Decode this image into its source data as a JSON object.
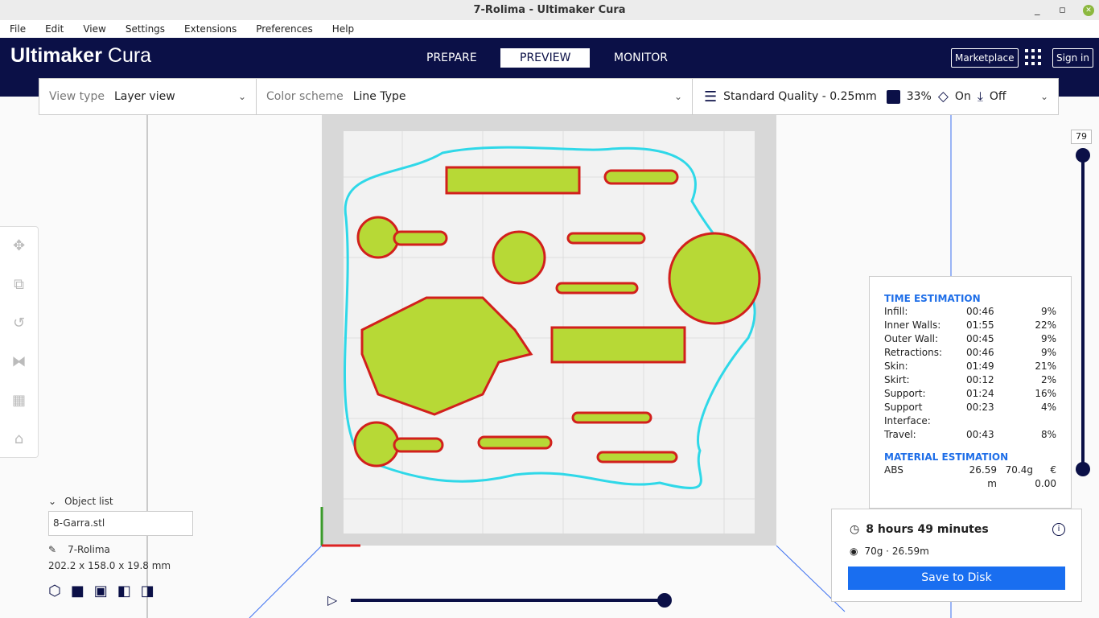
{
  "window": {
    "title": "7-Rolima - Ultimaker Cura",
    "minimize": "_",
    "maximize": "▫",
    "close": "✕"
  },
  "menu": [
    "File",
    "Edit",
    "View",
    "Settings",
    "Extensions",
    "Preferences",
    "Help"
  ],
  "header": {
    "logo_bold": "Ultimaker",
    "logo_light": " Cura",
    "tabs": [
      "PREPARE",
      "PREVIEW",
      "MONITOR"
    ],
    "active_tab": "PREVIEW",
    "marketplace": "Marketplace",
    "sign_in": "Sign in"
  },
  "view": {
    "view_type_label": "View type",
    "view_type": "Layer view",
    "color_scheme_label": "Color scheme",
    "color_scheme": "Line Type"
  },
  "print_setup": {
    "profile": "Standard Quality - 0.25mm",
    "infill": "33%",
    "support": "On",
    "adhesion": "Off"
  },
  "layer_slider": {
    "current_layer": "79",
    "position_fraction": 1.0
  },
  "time_estimation": {
    "title": "TIME ESTIMATION",
    "rows": [
      [
        "Infill:",
        "00:46",
        "9%"
      ],
      [
        "Inner Walls:",
        "01:55",
        "22%"
      ],
      [
        "Outer Wall:",
        "00:45",
        "9%"
      ],
      [
        "Retractions:",
        "00:46",
        "9%"
      ],
      [
        "Skin:",
        "01:49",
        "21%"
      ],
      [
        "Skirt:",
        "00:12",
        "2%"
      ],
      [
        "Support:",
        "01:24",
        "16%"
      ],
      [
        "Support Interface:",
        "00:23",
        "4%"
      ],
      [
        "Travel:",
        "00:43",
        "8%"
      ]
    ]
  },
  "material_estimation": {
    "title": "MATERIAL ESTIMATION",
    "rows": [
      [
        "ABS",
        "26.59 m",
        "70.4g",
        "€ 0.00"
      ]
    ]
  },
  "print_summary": {
    "time": "8 hours 49 minutes",
    "material": "70g · 26.59m",
    "save": "Save to Disk"
  },
  "object_list": {
    "title": "Object list",
    "file": "8-Garra.stl",
    "object": "7-Rolima",
    "dimensions": "202.2 x 158.0 x 19.8 mm"
  },
  "simulation": {
    "progress": 1.0
  }
}
